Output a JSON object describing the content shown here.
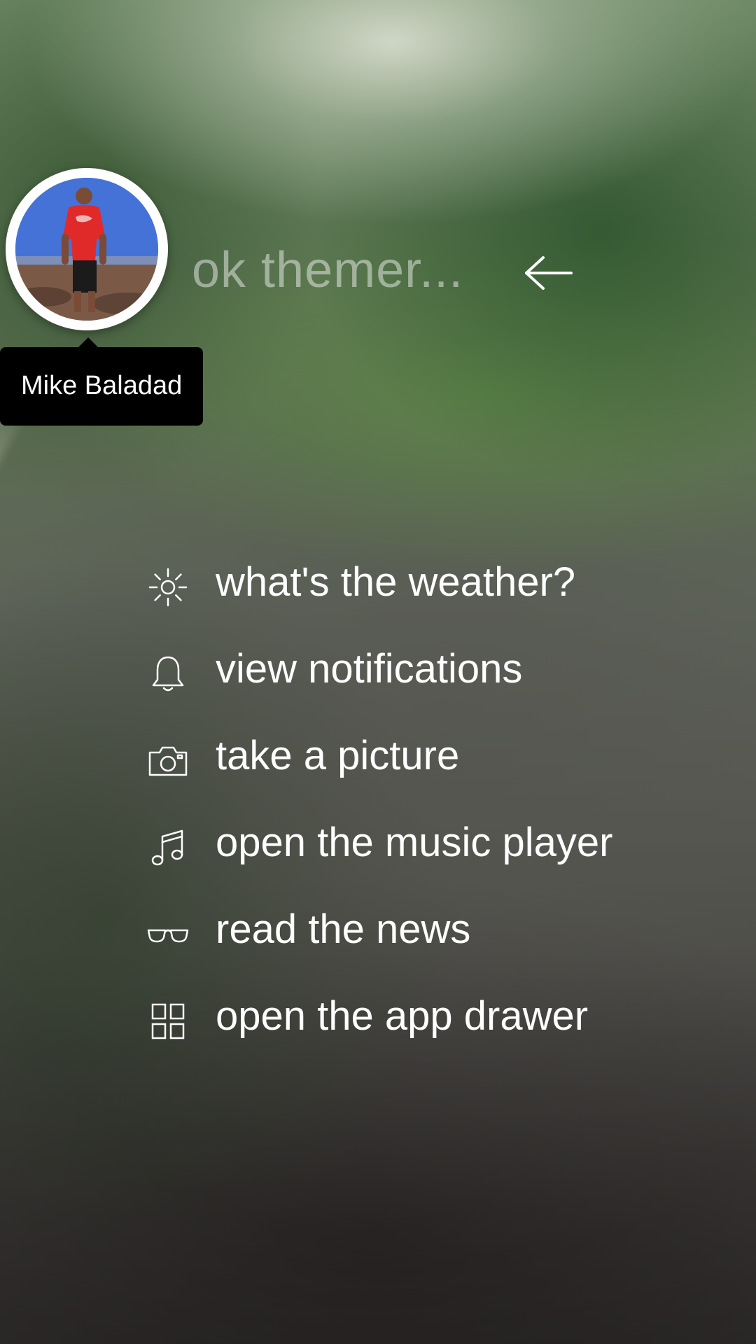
{
  "profile": {
    "name": "Mike Baladad"
  },
  "search": {
    "prompt": "ok themer..."
  },
  "commands": [
    {
      "icon": "sun-icon",
      "label": "what's the weather?"
    },
    {
      "icon": "bell-icon",
      "label": "view notifications"
    },
    {
      "icon": "camera-icon",
      "label": "take a picture"
    },
    {
      "icon": "music-note-icon",
      "label": "open the music player"
    },
    {
      "icon": "glasses-icon",
      "label": "read the news"
    },
    {
      "icon": "grid-icon",
      "label": "open the app drawer"
    }
  ]
}
